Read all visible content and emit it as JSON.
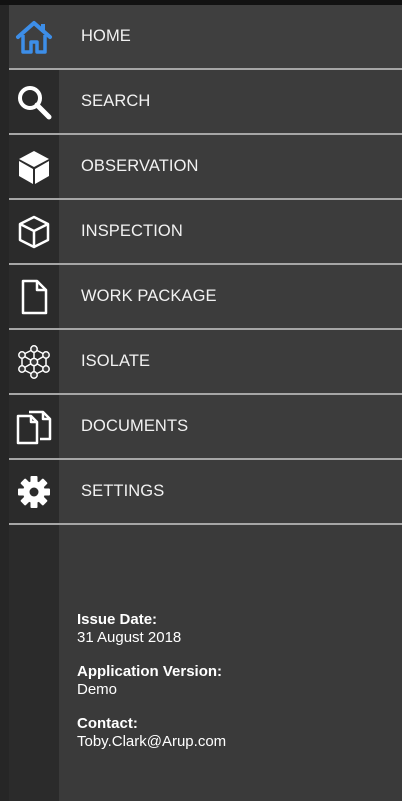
{
  "menu": {
    "items": [
      {
        "label": "HOME",
        "icon": "home-icon"
      },
      {
        "label": "SEARCH",
        "icon": "search-icon"
      },
      {
        "label": "OBSERVATION",
        "icon": "cube-solid-icon"
      },
      {
        "label": "INSPECTION",
        "icon": "cube-outline-icon"
      },
      {
        "label": "WORK PACKAGE",
        "icon": "document-icon"
      },
      {
        "label": "ISOLATE",
        "icon": "network-icon"
      },
      {
        "label": "DOCUMENTS",
        "icon": "documents-icon"
      },
      {
        "label": "SETTINGS",
        "icon": "gear-icon"
      }
    ],
    "active_item": "HOME"
  },
  "info": {
    "issue_date_label": "Issue Date:",
    "issue_date_value": "31 August 2018",
    "version_label": "Application Version:",
    "version_value": "Demo",
    "contact_label": "Contact:",
    "contact_value": "Toby.Clark@Arup.com"
  },
  "colors": {
    "accent": "#3d8ee8",
    "background": "#3a3a3a",
    "icon_column": "#2b2b2b",
    "divider": "#a6a6a6",
    "text": "#f2f2f2"
  }
}
